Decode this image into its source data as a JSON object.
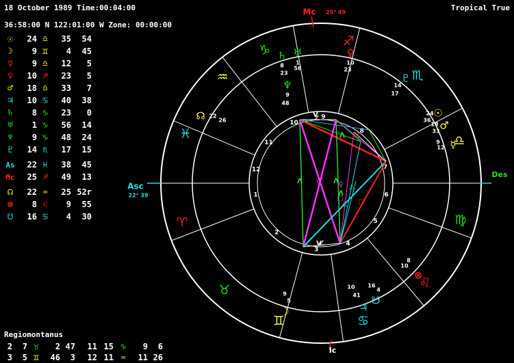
{
  "header": {
    "date_time": "18 October 1989 Time:00:04:00",
    "location": "36:58:00 N 122:01:00 W Zone: 00:00:00",
    "zodiac": "Tropical True"
  },
  "colors": {
    "fire": "#ff2020",
    "earth": "#20e020",
    "air": "#ffff20",
    "water": "#20e0e0",
    "purple": "#ff30ff",
    "blue": "#40a0ff",
    "white": "#ffffff",
    "background": "#000000"
  },
  "positions": [
    {
      "glyph": "☉",
      "color": "#ffff20",
      "deg": "24",
      "sign": "♎",
      "min": "35",
      "sec": "54"
    },
    {
      "glyph": "☽",
      "color": "#ffff20",
      "deg": "9",
      "sign": "♊",
      "min": "4",
      "sec": "45"
    },
    {
      "glyph": "☿",
      "color": "#ff2020",
      "deg": "9",
      "sign": "♎",
      "min": "12",
      "sec": "5"
    },
    {
      "glyph": "♀",
      "color": "#ff2020",
      "deg": "10",
      "sign": "♐",
      "min": "23",
      "sec": "5"
    },
    {
      "glyph": "♂",
      "color": "#ffff20",
      "deg": "18",
      "sign": "♎",
      "min": "33",
      "sec": "7"
    },
    {
      "glyph": "♃",
      "color": "#20e0e0",
      "deg": "10",
      "sign": "♋",
      "min": "40",
      "sec": "38"
    },
    {
      "glyph": "♄",
      "color": "#20e020",
      "deg": "8",
      "sign": "♑",
      "min": "23",
      "sec": "0"
    },
    {
      "glyph": "♅",
      "color": "#20e020",
      "deg": "1",
      "sign": "♑",
      "min": "56",
      "sec": "14"
    },
    {
      "glyph": "♆",
      "color": "#20e020",
      "deg": "9",
      "sign": "♑",
      "min": "48",
      "sec": "24"
    },
    {
      "glyph": "♇",
      "color": "#20e0e0",
      "deg": "14",
      "sign": "♏",
      "min": "17",
      "sec": "15"
    }
  ],
  "angles": [
    {
      "glyph": "As",
      "color": "#20e0e0",
      "deg": "22",
      "sign": "♓",
      "min": "38",
      "sec": "45"
    },
    {
      "glyph": "Mc",
      "color": "#ff2020",
      "deg": "25",
      "sign": "♐",
      "min": "49",
      "sec": "13"
    }
  ],
  "points": [
    {
      "glyph": "☊",
      "color": "#ffff20",
      "deg": "22",
      "sign": "♒",
      "min": "25",
      "sec": "52r"
    },
    {
      "glyph": "⊗",
      "color": "#ff2020",
      "deg": "8",
      "sign": "♌",
      "min": "9",
      "sec": "55"
    },
    {
      "glyph": "☋",
      "color": "#20e0e0",
      "deg": "16",
      "sign": "♋",
      "min": "4",
      "sec": "30"
    }
  ],
  "houses": {
    "title": "Regiomontanus",
    "rows": [
      {
        "h1": "2",
        "d1": "7",
        "s1": "♉",
        "h2": "2",
        "d2": "47",
        "h3": "11",
        "d3": "15",
        "s3": "♑",
        "h4": "9",
        "d4": "6"
      },
      {
        "h1": "3",
        "d1": "5",
        "s1": "♊",
        "h2": "46",
        "d2": "3",
        "h3": "12",
        "d3": "11",
        "s3": "♒",
        "h4": "11",
        "d4": "26"
      }
    ]
  },
  "wheel": {
    "asc_label": "Asc",
    "asc_deg": "22° 39",
    "des_label": "Des",
    "mc_label": "Mc",
    "mc_deg": "25° 49",
    "ic_label": "Ic",
    "house_numbers": [
      "1",
      "2",
      "3",
      "4",
      "5",
      "6",
      "7",
      "8",
      "9",
      "10",
      "11",
      "12"
    ],
    "zodiac_ring": [
      {
        "glyph": "♑",
        "color": "#20e020"
      },
      {
        "glyph": "♐",
        "color": "#ff2020"
      },
      {
        "glyph": "♏",
        "color": "#20e0e0"
      },
      {
        "glyph": "♎",
        "color": "#ffff20"
      },
      {
        "glyph": "♍",
        "color": "#20e020"
      },
      {
        "glyph": "♌",
        "color": "#ff2020"
      },
      {
        "glyph": "♋",
        "color": "#20e0e0"
      },
      {
        "glyph": "♊",
        "color": "#ffff20"
      },
      {
        "glyph": "♉",
        "color": "#20e020"
      },
      {
        "glyph": "♈",
        "color": "#ff2020"
      },
      {
        "glyph": "♓",
        "color": "#20e0e0"
      },
      {
        "glyph": "♒",
        "color": "#ffff20"
      }
    ],
    "planet_labels": [
      {
        "glyph": "♄",
        "color": "#20e020",
        "d": "8",
        "m": "23"
      },
      {
        "glyph": "♅",
        "color": "#20e020",
        "d": "1",
        "m": "56"
      },
      {
        "glyph": "♆",
        "color": "#20e020",
        "d": "9",
        "m": "48"
      },
      {
        "glyph": "♀",
        "color": "#ff2020",
        "d": "10",
        "m": "23"
      },
      {
        "glyph": "♇",
        "color": "#20e0e0",
        "d": "14",
        "m": "17"
      },
      {
        "glyph": "☉",
        "color": "#ffff20",
        "d": "24",
        "m": "36"
      },
      {
        "glyph": "♂",
        "color": "#ffff20",
        "d": "18",
        "m": "33"
      },
      {
        "glyph": "☿",
        "color": "#ffff20",
        "d": "9",
        "m": "12"
      },
      {
        "glyph": "☊",
        "color": "#ffff20",
        "d": "22",
        "m": "26"
      },
      {
        "glyph": "⊗",
        "color": "#ff2020",
        "d": "8",
        "m": "10"
      },
      {
        "glyph": "♃",
        "color": "#20e0e0",
        "d": "10",
        "m": "41"
      },
      {
        "glyph": "☋",
        "color": "#20e0e0",
        "d": "16",
        "m": "4"
      },
      {
        "glyph": "☽",
        "color": "#ffff20",
        "d": "9",
        "m": "5"
      }
    ],
    "aspect_markers": [
      "ᐱ",
      "ᐱ",
      "ᐱ",
      "ᐱ",
      "□",
      "□",
      "□",
      "□",
      "△",
      "△",
      "∠",
      "∠",
      "V",
      "V"
    ]
  }
}
